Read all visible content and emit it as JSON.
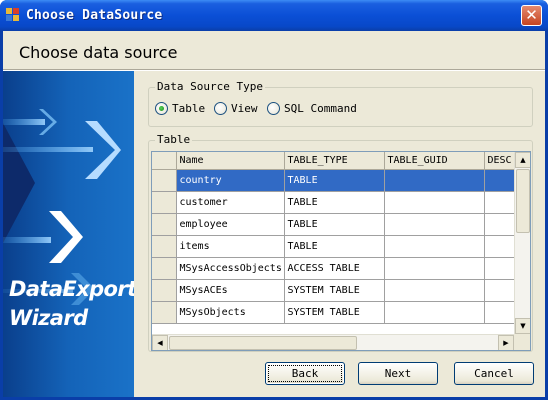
{
  "window": {
    "title": "Choose DataSource",
    "close_glyph": "✕",
    "icon": "app-icon"
  },
  "header": {
    "title": "Choose data source"
  },
  "banner": {
    "line1": "DataExport",
    "line2": "Wizard"
  },
  "datasource_type": {
    "legend": "Data Source Type",
    "options": [
      {
        "label": "Table",
        "checked": true
      },
      {
        "label": "View",
        "checked": false
      },
      {
        "label": "SQL Command",
        "checked": false
      }
    ]
  },
  "table_group": {
    "legend": "Table",
    "columns": [
      "Name",
      "TABLE_TYPE",
      "TABLE_GUID",
      "DESC"
    ],
    "rows": [
      {
        "name": "country",
        "type": "TABLE",
        "guid": "",
        "desc": "",
        "selected": true
      },
      {
        "name": "customer",
        "type": "TABLE",
        "guid": "",
        "desc": "",
        "selected": false
      },
      {
        "name": "employee",
        "type": "TABLE",
        "guid": "",
        "desc": "",
        "selected": false
      },
      {
        "name": "items",
        "type": "TABLE",
        "guid": "",
        "desc": "",
        "selected": false
      },
      {
        "name": "MSysAccessObjects",
        "type": "ACCESS TABLE",
        "guid": "",
        "desc": "",
        "selected": false
      },
      {
        "name": "MSysACEs",
        "type": "SYSTEM TABLE",
        "guid": "",
        "desc": "",
        "selected": false
      },
      {
        "name": "MSysObjects",
        "type": "SYSTEM TABLE",
        "guid": "",
        "desc": "",
        "selected": false
      }
    ]
  },
  "buttons": {
    "back": "Back",
    "next": "Next",
    "cancel": "Cancel"
  },
  "colors": {
    "titlebar": "#0b4fd6",
    "selection": "#316ac5",
    "dialog_bg": "#ece9d8",
    "radio_checked": "#21a121"
  }
}
